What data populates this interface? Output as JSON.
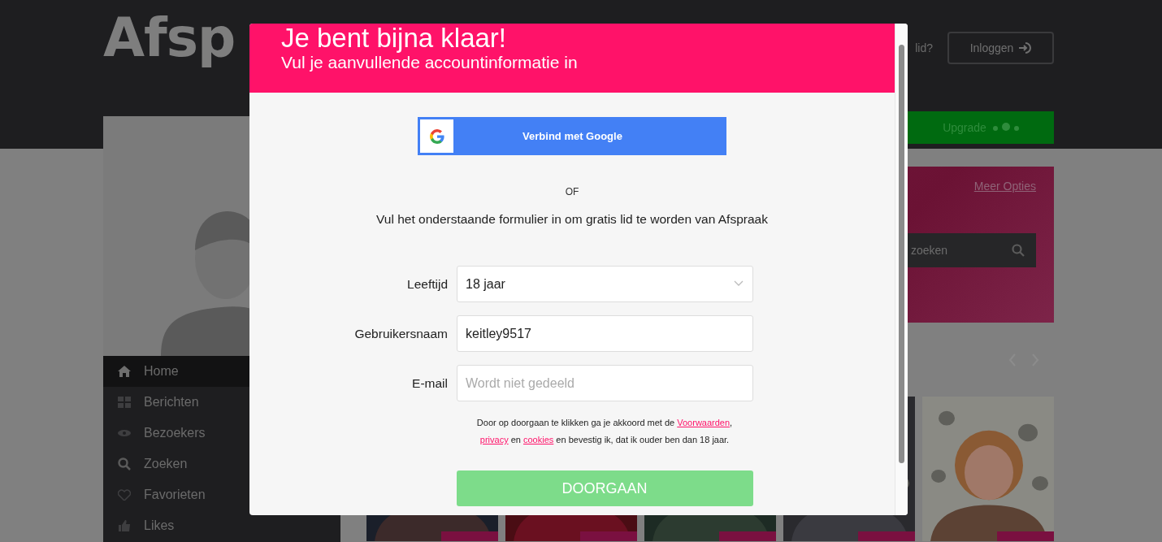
{
  "background": {
    "logo": "Afsp",
    "login_prompt": "lid?",
    "login_button": "Inloggen",
    "upgrade_button": "Upgrade",
    "nav": [
      {
        "label": "Home",
        "selected": true
      },
      {
        "label": "Berichten",
        "selected": false
      },
      {
        "label": "Bezoekers",
        "selected": false
      },
      {
        "label": "Zoeken",
        "selected": false
      },
      {
        "label": "Favorieten",
        "selected": false
      },
      {
        "label": "Likes",
        "selected": false
      }
    ],
    "search_card": {
      "link": "Meer Opties",
      "search_placeholder": "zoeken"
    }
  },
  "modal": {
    "title": "Je bent bijna klaar!",
    "subtitle": "Vul je aanvullende accountinformatie in",
    "google_button": "Verbind met Google",
    "separator": "OF",
    "intro": "Vul het onderstaande formulier in om gratis lid te worden van Afspraak",
    "fields": [
      {
        "kind": "select",
        "label": "Leeftijd",
        "value": "18 jaar"
      },
      {
        "kind": "text",
        "label": "Gebruikersnaam",
        "value": "keitley9517"
      },
      {
        "kind": "text",
        "label": "E-mail",
        "placeholder": "Wordt niet gedeeld"
      }
    ],
    "terms": [
      [
        {
          "text": "Door op doorgaan te klikken ga je akkoord met de ",
          "link": false
        },
        {
          "text": "Voorwaarden",
          "link": true
        },
        {
          "text": ",",
          "link": false
        }
      ],
      [
        {
          "text": "privacy",
          "link": true
        },
        {
          "text": " en ",
          "link": false
        },
        {
          "text": "cookies",
          "link": true
        },
        {
          "text": " en bevestig ik, dat ik ouder ben dan 18 jaar.",
          "link": false
        }
      ]
    ],
    "submit_button": "DOORGAAN"
  }
}
